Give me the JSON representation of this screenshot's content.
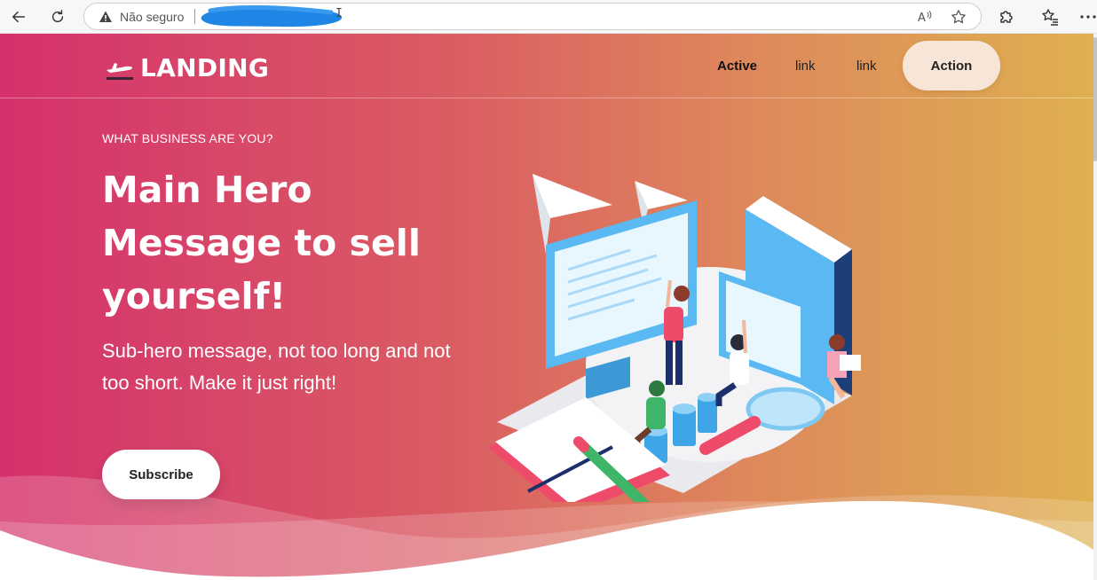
{
  "browser": {
    "back_icon": "arrow-left-icon",
    "reload_icon": "reload-icon",
    "security_icon": "warning-triangle-icon",
    "security_label": "Não seguro",
    "read_aloud_icon": "read-aloud-icon",
    "favorite_icon": "star-icon",
    "extensions_icon": "puzzle-icon",
    "favorites_icon": "favorites-list-icon",
    "menu_icon": "more-icon"
  },
  "header": {
    "logo_icon": "airplane-takeoff-icon",
    "logo_text": "LANDING",
    "nav": [
      {
        "label": "Active",
        "active": true
      },
      {
        "label": "link",
        "active": false
      },
      {
        "label": "link",
        "active": false
      }
    ],
    "action_label": "Action"
  },
  "hero": {
    "eyebrow": "WHAT BUSINESS ARE YOU?",
    "title": "Main Hero Message to sell yourself!",
    "subtitle": "Sub-hero message, not too long and not too short. Make it just right!",
    "cta_label": "Subscribe"
  },
  "colors": {
    "gradient_start": "#d5316c",
    "gradient_end": "#dfb050",
    "action_button": "#f7e6d8",
    "accent_blue": "#53b6f3",
    "accent_pink": "#ee4a6a"
  }
}
